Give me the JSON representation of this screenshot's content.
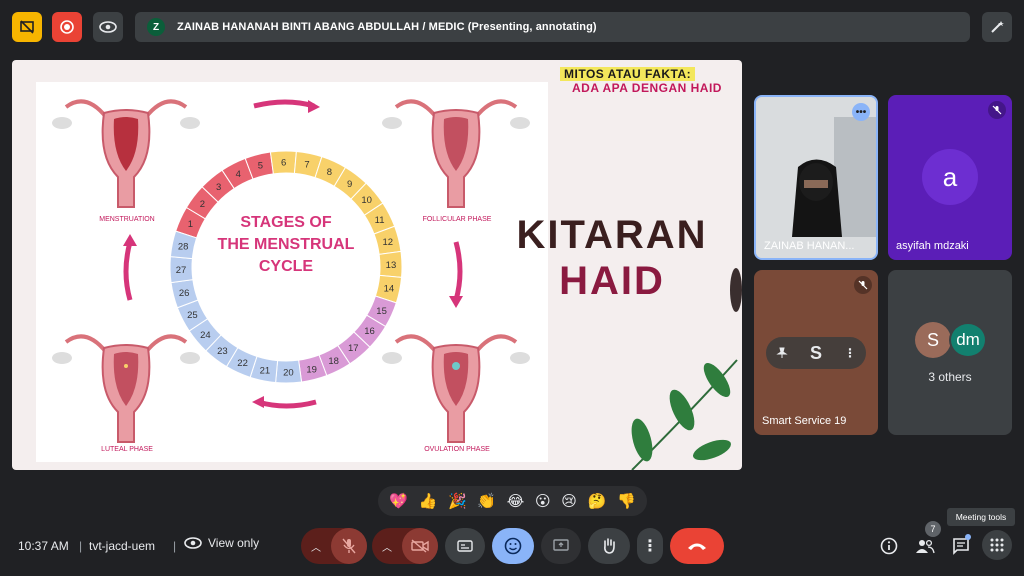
{
  "topbar": {
    "presenter_initial": "Z",
    "presenter_text": "ZAINAB HANANAH BINTI ABANG ABDULLAH / MEDIC (Presenting, annotating)"
  },
  "slide": {
    "title_line1": "MITOS ATAU FAKTA:",
    "title_line2": "ADA APA DENGAN HAID",
    "big_line1": "KITARAN",
    "big_line2": "HAID",
    "cycle_title_l1": "STAGES OF",
    "cycle_title_l2": "THE MENSTRUAL",
    "cycle_title_l3": "CYCLE",
    "phase_labels": [
      "MENSTRUATION",
      "FOLLICULAR PHASE",
      "LUTEAL PHASE",
      "OVULATION PHASE"
    ],
    "days": [
      "1",
      "2",
      "3",
      "4",
      "5",
      "6",
      "7",
      "8",
      "9",
      "10",
      "11",
      "12",
      "13",
      "14",
      "15",
      "16",
      "17",
      "18",
      "19",
      "20",
      "21",
      "22",
      "23",
      "24",
      "25",
      "26",
      "27",
      "28"
    ],
    "colors": {
      "menstrual": "#e8626f",
      "follicular": "#f8d16a",
      "ovulation": "#d99ad6",
      "luteal": "#b8cdef"
    }
  },
  "participants": {
    "zainab_name": "ZAINAB HANAN...",
    "asyifah_initial": "a",
    "asyifah_name": "asyifah mdzaki",
    "smart_name": "Smart Service 19",
    "others_initial1": "S",
    "others_initial2": "dm",
    "others_label": "3 others"
  },
  "reactions": [
    "💖",
    "👍",
    "🎉",
    "👏",
    "😂",
    "😮",
    "😢",
    "🤔",
    "👎"
  ],
  "bottombar": {
    "time": "10:37 AM",
    "meeting_code": "tvt-jacd-uem",
    "view_only": "View only",
    "people_count": "7",
    "tooltip": "Meeting tools"
  }
}
